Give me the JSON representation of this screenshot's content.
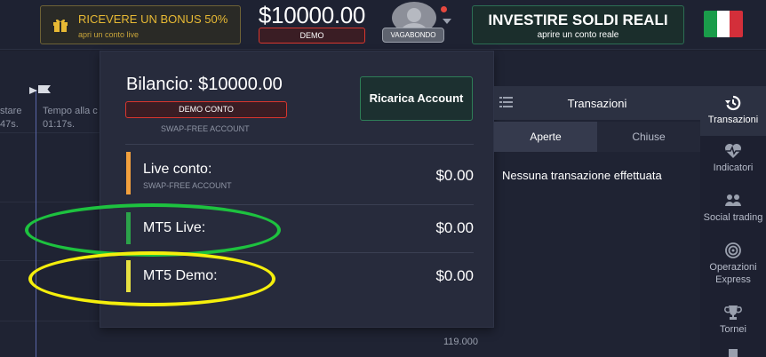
{
  "header": {
    "bonus_title": "RICEVERE UN BONUS 50%",
    "bonus_subtitle": "apri un conto live",
    "balance": "$10000.00",
    "account_mode": "DEMO",
    "username": "VAGABONDO",
    "invest_title": "INVESTIRE SOLDI REALI",
    "invest_subtitle": "aprire un conto reale",
    "flag_colors": [
      "#1a9c4a",
      "#ffffff",
      "#d32f3a"
    ]
  },
  "chart": {
    "label_1": "stare",
    "label_1_time": "47s.",
    "label_2": "Tempo alla c",
    "label_2_time": "01:17s.",
    "price": "119.000"
  },
  "account_panel": {
    "balance_label": "Bilancio: $10000.00",
    "demo_badge": "DEMO CONTO",
    "swap_label": "SWAP-FREE ACCOUNT",
    "recharge_button": "Ricarica Account",
    "accounts": [
      {
        "name": "Live conto:",
        "sub": "SWAP-FREE ACCOUNT",
        "amount": "$0.00",
        "color": "#f2a03d"
      },
      {
        "name": "MT5 Live:",
        "amount": "$0.00",
        "color": "#2ca24a"
      },
      {
        "name": "MT5 Demo:",
        "amount": "$0.00",
        "color": "#e6e042"
      }
    ]
  },
  "transactions": {
    "title": "Transazioni",
    "tabs": [
      "Aperte",
      "Chiuse"
    ],
    "empty_message": "Nessuna transazione effettuata"
  },
  "sidebar": {
    "items": [
      {
        "label": "Transazioni",
        "icon": "history-icon"
      },
      {
        "label": "Indicatori",
        "icon": "heartbeat-icon"
      },
      {
        "label": "Social trading",
        "icon": "users-icon"
      },
      {
        "label": "Operazioni Express",
        "label_l1": "Operazioni",
        "label_l2": "Express",
        "icon": "target-icon"
      },
      {
        "label": "Tornei",
        "icon": "trophy-icon"
      }
    ]
  }
}
